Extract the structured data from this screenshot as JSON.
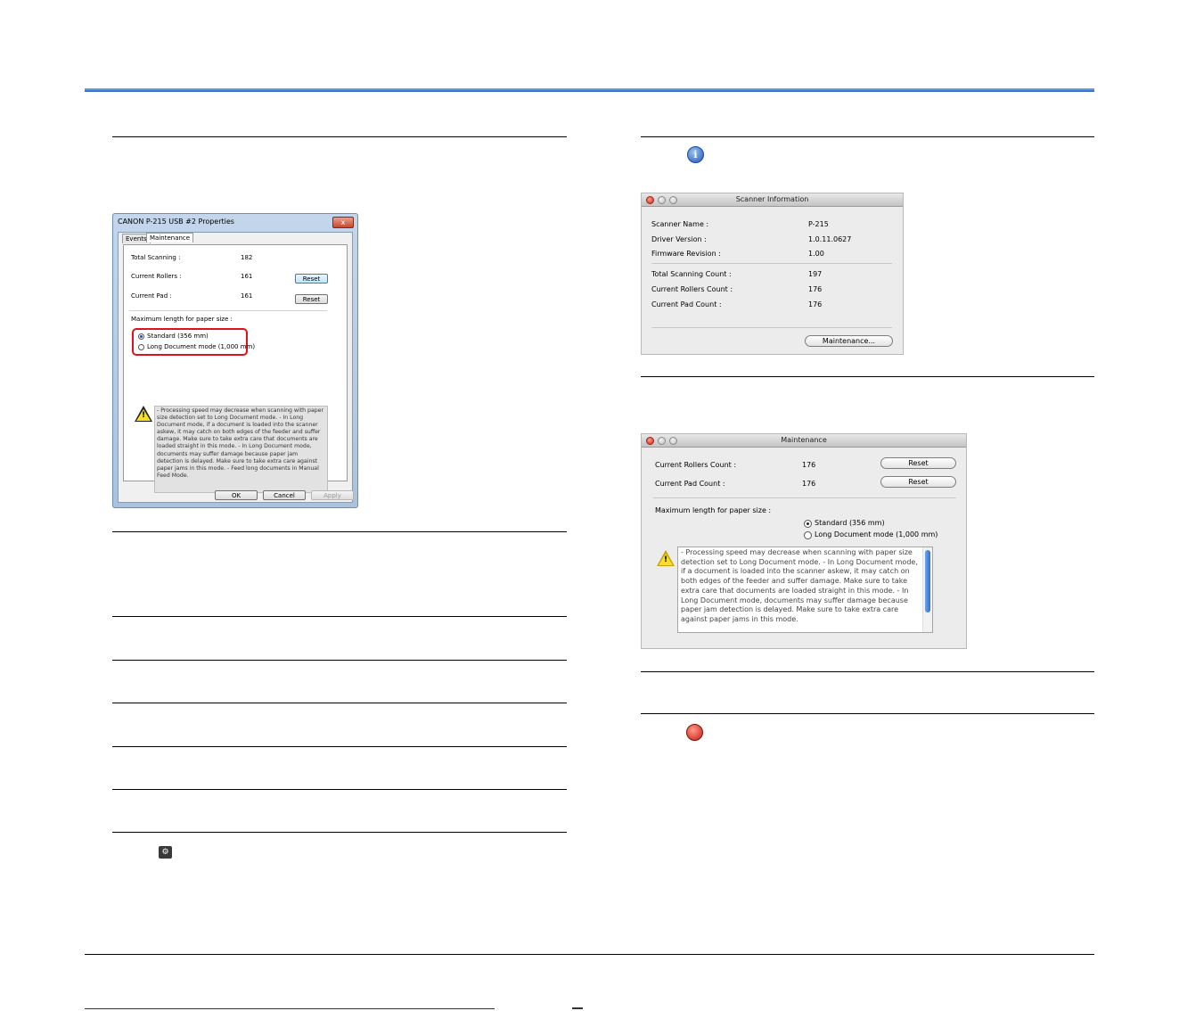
{
  "windows_dialog": {
    "title": "CANON P-215 USB #2 Properties",
    "close_glyph": "x",
    "tabs": [
      "Events",
      "Maintenance"
    ],
    "rows": [
      {
        "label": "Total Scanning :",
        "value": "182"
      },
      {
        "label": "Current Rollers :",
        "value": "161",
        "button": "Reset"
      },
      {
        "label": "Current Pad :",
        "value": "161",
        "button": "Reset"
      }
    ],
    "paper_size_label": "Maximum length for paper size :",
    "options": [
      "Standard (356 mm)",
      "Long Document mode (1,000 mm)"
    ],
    "note": "- Processing speed may decrease when scanning with paper size detection set to Long Document mode. - In Long Document mode, if a document is loaded into the scanner askew, it may catch on both edges of the feeder and suffer damage. Make sure to take extra care that documents are loaded straight in this mode. - In Long Document mode, documents may suffer damage because paper jam detection is delayed. Make sure to take extra care against paper jams in this mode. - Feed long documents in Manual Feed Mode.",
    "buttons": {
      "ok": "OK",
      "cancel": "Cancel",
      "apply": "Apply"
    }
  },
  "scanner_info": {
    "title": "Scanner Information",
    "rows": [
      {
        "label": "Scanner Name :",
        "value": "P-215"
      },
      {
        "label": "Driver Version :",
        "value": "1.0.11.0627"
      },
      {
        "label": "Firmware Revision :",
        "value": "1.00"
      },
      {
        "label": "Total Scanning Count :",
        "value": "197"
      },
      {
        "label": "Current Rollers Count :",
        "value": "176"
      },
      {
        "label": "Current Pad Count :",
        "value": "176"
      }
    ],
    "maintenance_button": "Maintenance..."
  },
  "maintenance": {
    "title": "Maintenance",
    "rows": [
      {
        "label": "Current Rollers Count :",
        "value": "176",
        "button": "Reset"
      },
      {
        "label": "Current Pad Count :",
        "value": "176",
        "button": "Reset"
      }
    ],
    "paper_size_label": "Maximum length for paper size :",
    "options": [
      "Standard (356 mm)",
      "Long Document mode (1,000 mm)"
    ],
    "note": "- Processing speed may decrease when scanning with paper size detection set to Long Document mode. - In Long Document mode, if a document is loaded into the scanner askew, it may catch on both edges of the feeder and suffer damage. Make sure to take extra care that documents are loaded straight in this mode. - In Long Document mode, documents may suffer damage because paper jam detection is delayed. Make sure to take extra care against paper jams in this mode."
  },
  "icons": {
    "info": "i",
    "gear": "⚙",
    "warning": "!"
  },
  "colors": {
    "header_rule": "#1d5fb4",
    "highlight": "#e0111e",
    "stop_button": "#d91c1c"
  }
}
